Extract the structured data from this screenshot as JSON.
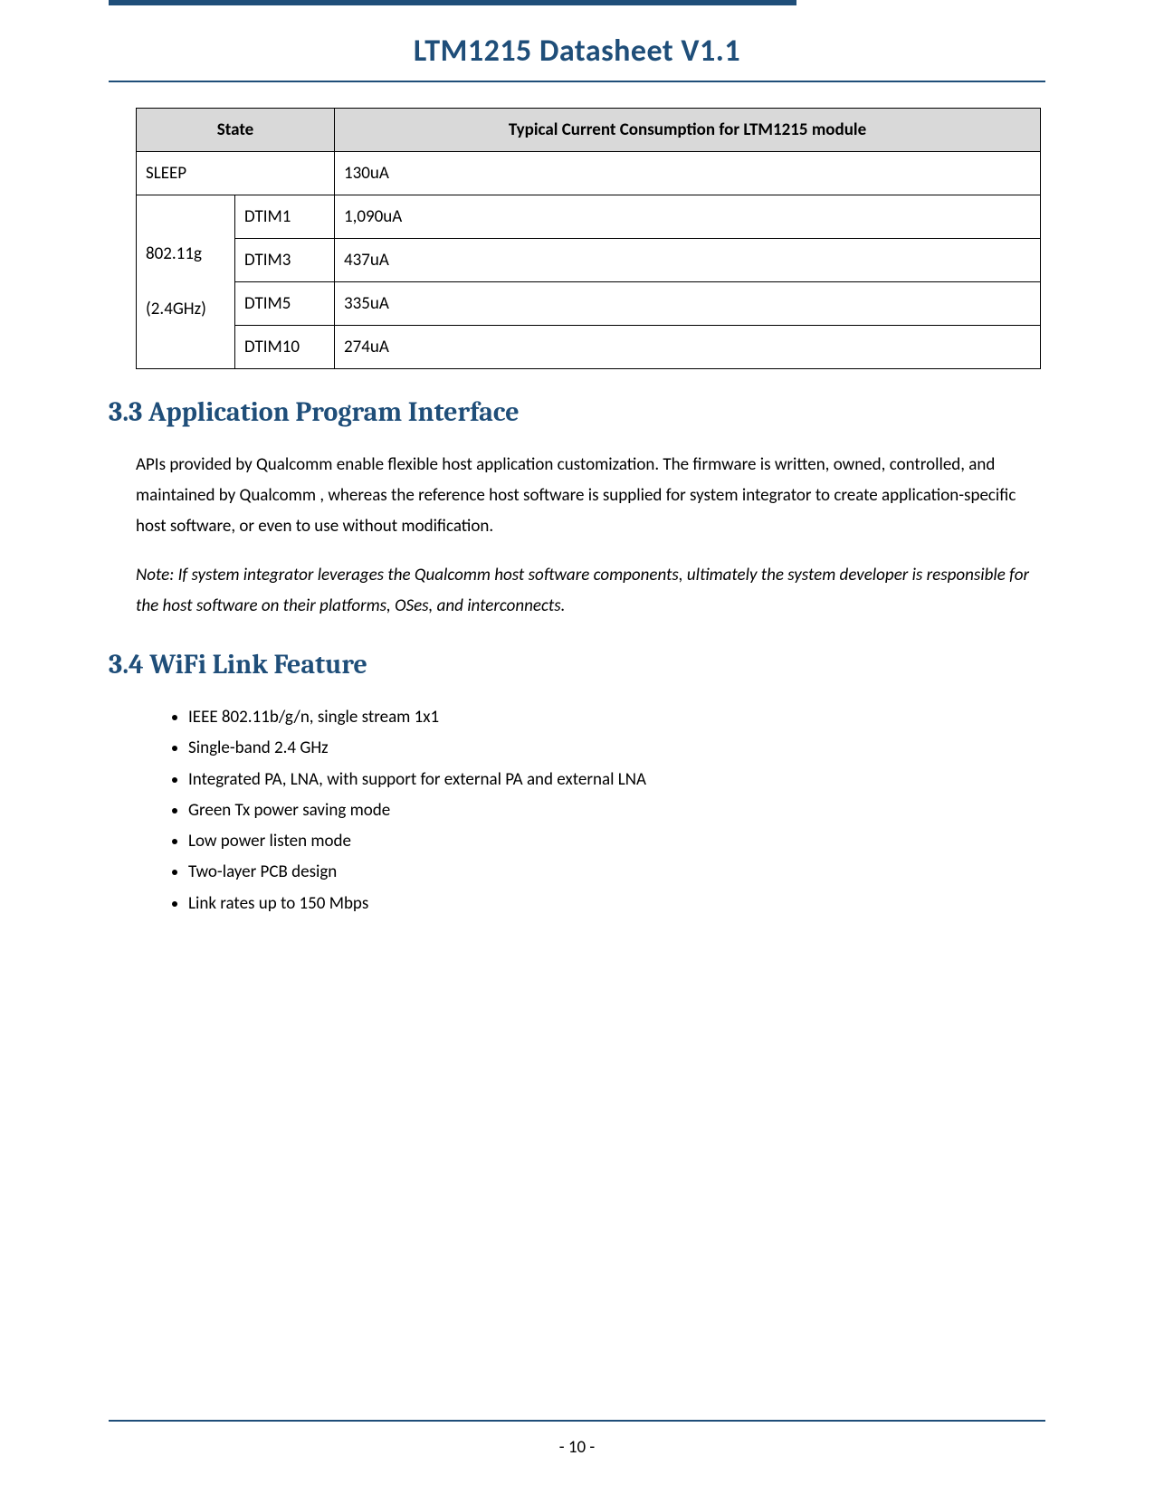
{
  "doc_title": "LTM1215 Datasheet V1.1",
  "table": {
    "header": {
      "state": "State",
      "value": "Typical Current Consumption for LTM1215 module"
    },
    "sleep": {
      "label": "SLEEP",
      "value": "130uA"
    },
    "group": {
      "label_line1": "802.11g",
      "label_line2": "(2.4GHz)",
      "rows": [
        {
          "sub": "DTIM1",
          "value": "1,090uA"
        },
        {
          "sub": "DTIM3",
          "value": "437uA"
        },
        {
          "sub": "DTIM5",
          "value": "335uA"
        },
        {
          "sub": "DTIM10",
          "value": "274uA"
        }
      ]
    }
  },
  "section_33": {
    "heading": "3.3 Application Program Interface",
    "para": "APIs provided by Qualcomm enable flexible host application customization. The firmware is written, owned, controlled, and maintained by Qualcomm , whereas the reference host software is supplied for system integrator to create application-specific host software, or even to use without modification.",
    "note": "Note: If system integrator leverages the Qualcomm host software components, ultimately the system developer is responsible for the host software on their platforms, OSes, and interconnects."
  },
  "section_34": {
    "heading": "3.4    WiFi Link Feature",
    "items": [
      "IEEE 802.11b/g/n, single stream 1x1",
      "Single-band 2.4 GHz",
      "Integrated PA, LNA, with support for external PA and external LNA",
      "Green Tx power saving mode",
      "Low power listen mode",
      "Two-layer PCB design",
      "Link rates up to 150 Mbps"
    ]
  },
  "page_number": "- 10 -"
}
